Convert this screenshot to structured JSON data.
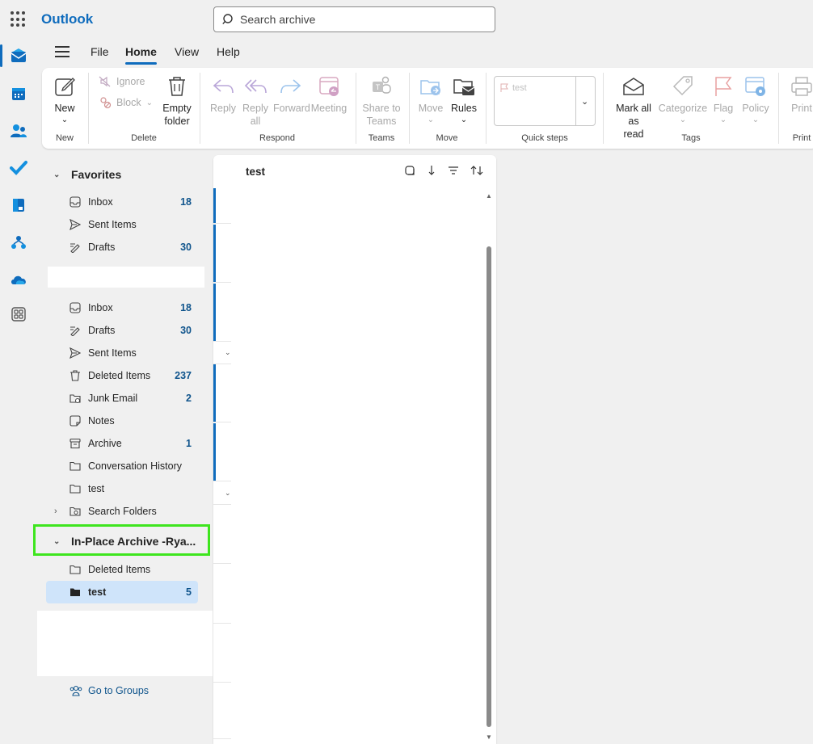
{
  "app": {
    "name": "Outlook"
  },
  "search": {
    "placeholder": "Search archive"
  },
  "rail": {
    "items": [
      {
        "name": "mail-icon",
        "color": "#0f6cbd"
      },
      {
        "name": "calendar-icon",
        "color": "#0f6cbd"
      },
      {
        "name": "people-icon",
        "color": "#0f6cbd"
      },
      {
        "name": "todo-icon",
        "color": "#0f6cbd"
      },
      {
        "name": "word-icon",
        "color": "#0f6cbd"
      },
      {
        "name": "org-explorer-icon",
        "color": "#0f6cbd"
      },
      {
        "name": "onedrive-icon",
        "color": "#0f6cbd"
      },
      {
        "name": "more-apps-icon",
        "color": "#555555"
      }
    ]
  },
  "menu": {
    "tabs": [
      {
        "label": "File"
      },
      {
        "label": "Home"
      },
      {
        "label": "View"
      },
      {
        "label": "Help"
      }
    ],
    "active": "Home"
  },
  "ribbon": {
    "new": {
      "label": "New",
      "group": "New"
    },
    "ignore": {
      "label": "Ignore"
    },
    "block": {
      "label": "Block"
    },
    "empty_folder": {
      "line1": "Empty",
      "line2": "folder"
    },
    "delete_group": "Delete",
    "reply": {
      "label": "Reply"
    },
    "reply_all": {
      "line1": "Reply",
      "line2": "all"
    },
    "forward": {
      "label": "Forward"
    },
    "meeting": {
      "label": "Meeting"
    },
    "respond_group": "Respond",
    "share_teams": {
      "line1": "Share to",
      "line2": "Teams"
    },
    "teams_group": "Teams",
    "move": {
      "label": "Move"
    },
    "rules": {
      "label": "Rules"
    },
    "move_group": "Move",
    "quick_steps": {
      "item": "test",
      "group": "Quick steps"
    },
    "mark_all_read": {
      "line1": "Mark all as",
      "line2": "read"
    },
    "categorize": {
      "label": "Categorize"
    },
    "flag": {
      "label": "Flag"
    },
    "policy": {
      "label": "Policy"
    },
    "tags_group": "Tags",
    "print": {
      "label": "Print",
      "group": "Print"
    }
  },
  "folders": {
    "favorites_label": "Favorites",
    "favorites": [
      {
        "name": "Inbox",
        "count": "18",
        "icon": "inbox-icon"
      },
      {
        "name": "Sent Items",
        "count": "",
        "icon": "send-icon"
      },
      {
        "name": "Drafts",
        "count": "30",
        "icon": "drafts-icon"
      }
    ],
    "mailbox": [
      {
        "name": "Inbox",
        "count": "18",
        "icon": "inbox-icon"
      },
      {
        "name": "Drafts",
        "count": "30",
        "icon": "drafts-icon"
      },
      {
        "name": "Sent Items",
        "count": "",
        "icon": "send-icon"
      },
      {
        "name": "Deleted Items",
        "count": "237",
        "icon": "trash-icon"
      },
      {
        "name": "Junk Email",
        "count": "2",
        "icon": "junk-icon"
      },
      {
        "name": "Notes",
        "count": "",
        "icon": "notes-icon"
      },
      {
        "name": "Archive",
        "count": "1",
        "icon": "archive-icon"
      },
      {
        "name": "Conversation History",
        "count": "",
        "icon": "folder-icon"
      },
      {
        "name": "test",
        "count": "",
        "icon": "folder-icon"
      },
      {
        "name": "Search Folders",
        "count": "",
        "icon": "search-folder-icon"
      }
    ],
    "archive_label": "In-Place Archive -Rya...",
    "archive": [
      {
        "name": "Deleted Items",
        "count": "",
        "icon": "folder-icon"
      },
      {
        "name": "test",
        "count": "5",
        "icon": "folder-filled-icon",
        "selected": true
      }
    ],
    "groups_link": "Go to Groups"
  },
  "message_list": {
    "title": "test"
  },
  "colors": {
    "accent": "#0f6cbd",
    "selected": "#cfe4fa",
    "highlight": "#3ee51e"
  }
}
